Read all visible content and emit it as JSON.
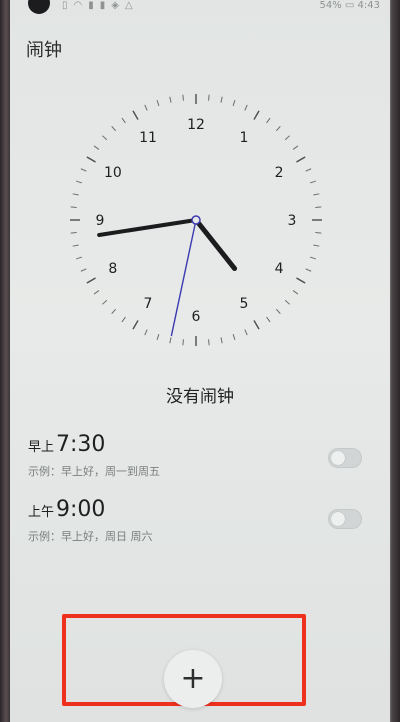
{
  "status_bar": {
    "left_icons": [
      "sim-icon",
      "wifi-icon",
      "notification-icon",
      "notification-icon",
      "notification-icon",
      "notification-icon"
    ],
    "battery": "54%",
    "time": "4:43"
  },
  "header": {
    "title": "闹钟"
  },
  "clock": {
    "numerals": [
      "12",
      "1",
      "2",
      "3",
      "4",
      "5",
      "6",
      "7",
      "8",
      "9",
      "10",
      "11"
    ],
    "hour": 4,
    "minute": 43,
    "second": 32
  },
  "main": {
    "no_alarm_text": "没有闹钟"
  },
  "alarms": [
    {
      "period": "早上",
      "time": "7:30",
      "desc": "示例：早上好，周一到周五",
      "enabled": false
    },
    {
      "period": "上午",
      "time": "9:00",
      "desc": "示例：早上好，周日 周六",
      "enabled": false
    }
  ],
  "fab": {
    "label": "+"
  },
  "colors": {
    "highlight_box": "#f0301f",
    "second_hand": "#3b3ab0",
    "hands": "#1c1c1e"
  }
}
